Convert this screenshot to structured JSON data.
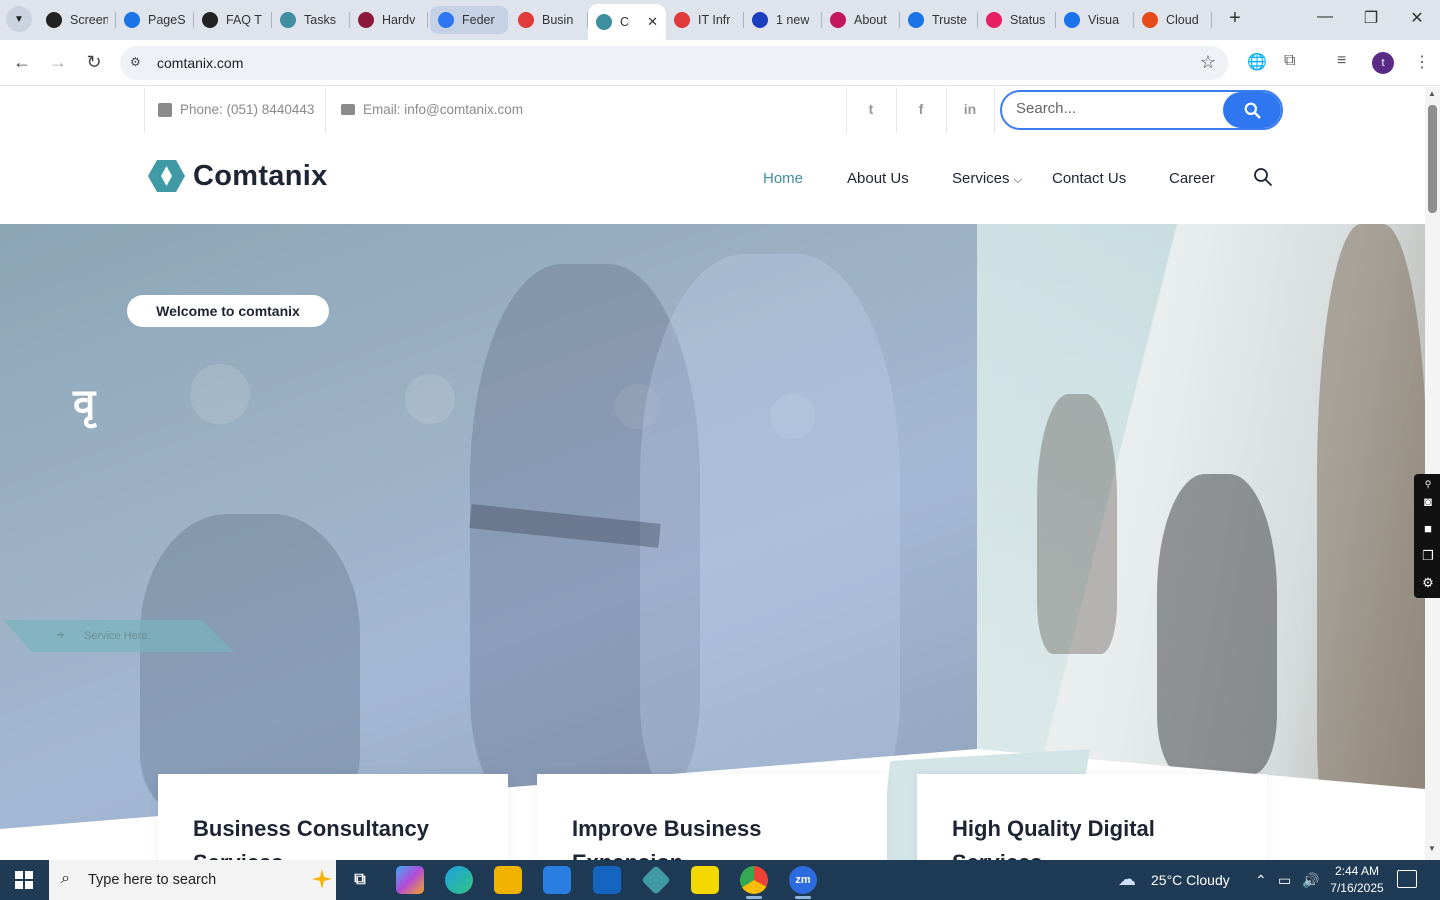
{
  "browser": {
    "tabs": [
      {
        "label": "Screen",
        "icon_color": "#222222",
        "icon": "eye-icon"
      },
      {
        "label": "PageS",
        "icon_color": "#1a73e8",
        "icon": "gauge-icon"
      },
      {
        "label": "FAQ T",
        "icon_color": "#222222",
        "icon": "spiral-icon"
      },
      {
        "label": "Tasks",
        "icon_color": "#3f8fa0",
        "icon": "comtanix-icon"
      },
      {
        "label": "Hardv",
        "icon_color": "#8b1a3a",
        "icon": "v-icon"
      },
      {
        "label": "Feder",
        "icon_color": "#2e77f0",
        "icon": "check-icon"
      },
      {
        "label": "Busin",
        "icon_color": "#e03a3a",
        "icon": "diamond-icon"
      },
      {
        "label": "C",
        "icon_color": "#3f8fa0",
        "icon": "comtanix-icon"
      },
      {
        "label": "IT Infr",
        "icon_color": "#e03a3a",
        "icon": "diamond-icon"
      },
      {
        "label": "1 new",
        "icon_color": "#1a3fbf",
        "icon": "x-icon"
      },
      {
        "label": "About",
        "icon_color": "#c2185b",
        "icon": "swirl-icon"
      },
      {
        "label": "Truste",
        "icon_color": "#1a73e8",
        "icon": "scale-icon"
      },
      {
        "label": "Status",
        "icon_color": "#e91e63",
        "icon": "pen-icon"
      },
      {
        "label": "Visua",
        "icon_color": "#1a73e8",
        "icon": "pulse-icon"
      },
      {
        "label": "Cloud",
        "icon_color": "#e64a19",
        "icon": "slash-icon"
      }
    ],
    "active_tab_index": 7,
    "highlighted_tab_index": 5,
    "url": "comtanix.com",
    "profile_initial": "t"
  },
  "site": {
    "topbar": {
      "phone": "Phone: (051) 8440443",
      "email": "Email: info@comtanix.com",
      "search_placeholder": "Search..."
    },
    "logo_text": "Comtanix",
    "nav": [
      "Home",
      "About Us",
      "Services",
      "Contact Us",
      "Career"
    ],
    "nav_active": "Home",
    "hero": {
      "badge": "Welcome to comtanix",
      "glyph": "वृ",
      "ghost_tab": "Service Here"
    },
    "cards": [
      {
        "title": "Business Consultancy Services"
      },
      {
        "title": "Improve Business Expansion"
      },
      {
        "title": "High Quality Digital Services"
      }
    ],
    "colors": {
      "accent": "#3f8fa0",
      "search_button": "#2e77f0",
      "text": "#1d2433"
    }
  },
  "taskbar": {
    "search_placeholder": "Type here to search",
    "weather": "25°C  Cloudy",
    "time": "2:44 AM",
    "date": "7/16/2025"
  }
}
